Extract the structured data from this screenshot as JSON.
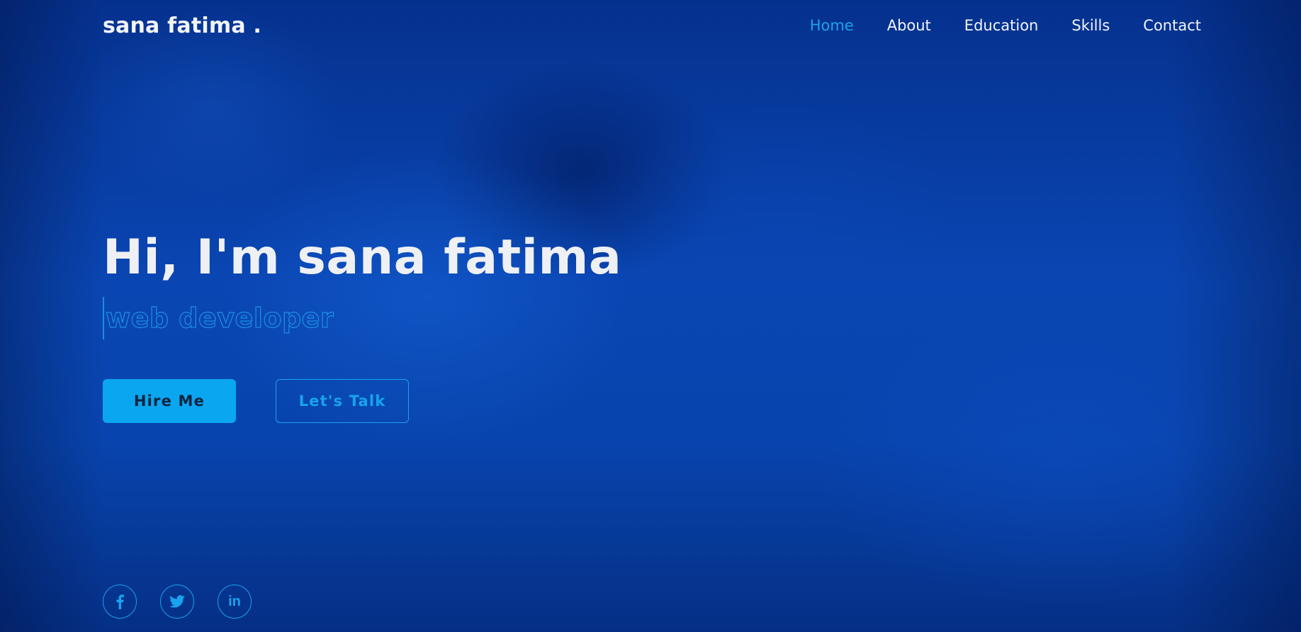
{
  "navbar": {
    "logo": "sana fatima .",
    "links": [
      {
        "label": "Home",
        "active": true
      },
      {
        "label": "About",
        "active": false
      },
      {
        "label": "Education",
        "active": false
      },
      {
        "label": "Skills",
        "active": false
      },
      {
        "label": "Contact",
        "active": false
      }
    ]
  },
  "hero": {
    "greeting": "Hi, I'm sana fatima",
    "role": "web developer",
    "buttons": {
      "primary": "Hire Me",
      "secondary": "Let's Talk"
    }
  },
  "socials": [
    {
      "icon": "facebook-icon"
    },
    {
      "icon": "twitter-icon"
    },
    {
      "icon": "linkedin-icon",
      "text": "in"
    }
  ],
  "colors": {
    "accent": "#0aa6f0",
    "text": "#eef0f4",
    "background": "#0844ad"
  }
}
